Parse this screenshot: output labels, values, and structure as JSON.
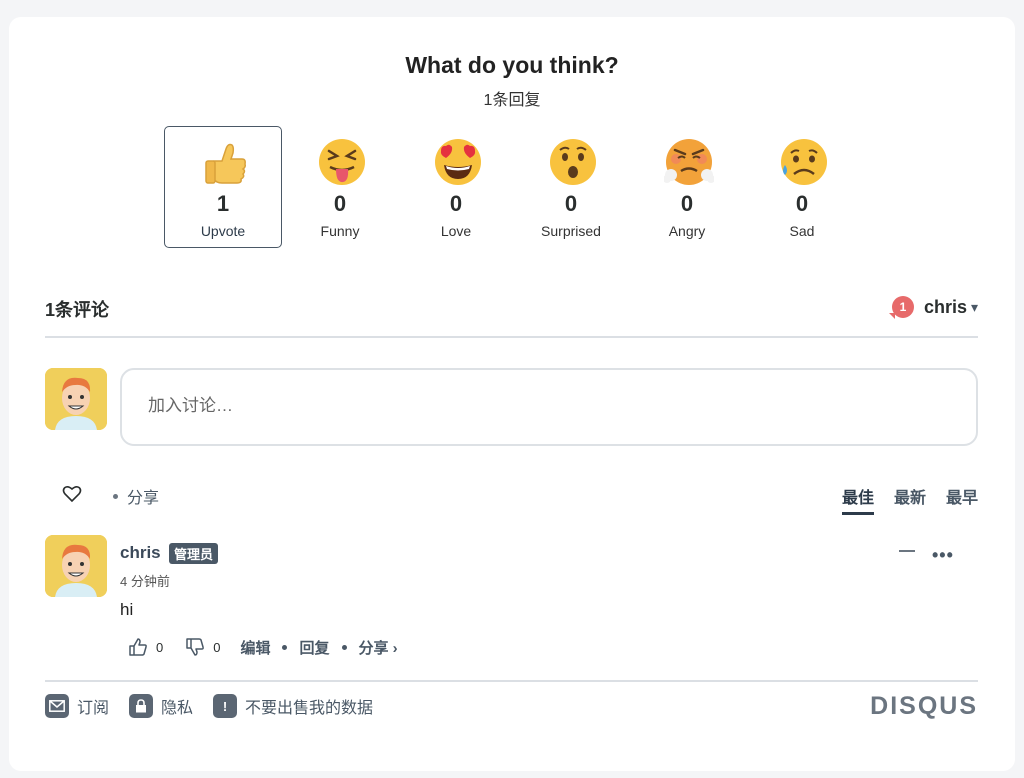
{
  "header": {
    "title": "What do you think?",
    "reply_count": "1条回复"
  },
  "reactions": [
    {
      "icon": "thumbs-up-emoji",
      "count": "1",
      "label": "Upvote",
      "selected": true
    },
    {
      "icon": "squinting-tongue-emoji",
      "count": "0",
      "label": "Funny",
      "selected": false
    },
    {
      "icon": "heart-eyes-emoji",
      "count": "0",
      "label": "Love",
      "selected": false
    },
    {
      "icon": "surprised-emoji",
      "count": "0",
      "label": "Surprised",
      "selected": false
    },
    {
      "icon": "angry-steam-emoji",
      "count": "0",
      "label": "Angry",
      "selected": false
    },
    {
      "icon": "sad-sweat-emoji",
      "count": "0",
      "label": "Sad",
      "selected": false
    }
  ],
  "comments_bar": {
    "count_label": "1条评论",
    "notification_count": "1",
    "username": "chris",
    "caret": "▾"
  },
  "composer": {
    "placeholder": "加入讨论…"
  },
  "toolbar": {
    "share_label": "分享",
    "sorts": [
      "最佳",
      "最新",
      "最早"
    ],
    "active_sort": "最佳"
  },
  "comment": {
    "author": "chris",
    "badge": "管理员",
    "timestamp": "4 分钟前",
    "text": "hi",
    "upvotes": "0",
    "downvotes": "0",
    "collapse": "−",
    "more": "•••",
    "edit_label": "编辑",
    "reply_label": "回复",
    "share_label": "分享 ›"
  },
  "footer": {
    "subscribe": "订阅",
    "privacy": "隐私",
    "do_not_sell": "不要出售我的数据",
    "brand": "DISQUS"
  },
  "colors": {
    "accent": "#2d3b4a",
    "notification": "#e76a6a",
    "badge": "#4a5866",
    "divider": "#dbdfe4"
  }
}
